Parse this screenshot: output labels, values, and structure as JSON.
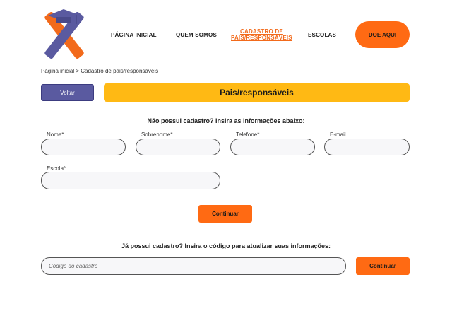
{
  "header": {
    "logo": {
      "icon": "graduation-logo-icon",
      "colors": {
        "orange": "#f26a1b",
        "purple": "#5a5aa0"
      }
    },
    "nav": [
      {
        "label": "PÁGINA INICIAL"
      },
      {
        "label": "QUEM SOMOS"
      },
      {
        "label_line1": "CADASTRO DE",
        "label_line2": "PAIS/RESPONSÁVEIS",
        "active": true
      },
      {
        "label": "ESCOLAS"
      }
    ],
    "donate_label": "DOE AQUI"
  },
  "breadcrumb": "Página inicial > Cadastro de pais/responsáveis",
  "back_label": "Voltar",
  "banner_title": "Pais/responsáveis",
  "new_section": {
    "title": "Não possui cadastro? Insira as informações abaixo:",
    "fields": {
      "nome": "Nome*",
      "sobrenome": "Sobrenome*",
      "telefone": "Telefone*",
      "email": "E-mail",
      "escola": "Escola*"
    },
    "continue_label": "Continuar"
  },
  "existing_section": {
    "title": "Já possui cadastro? Insira o código para atualizar suas informações:",
    "code_placeholder": "Código do cadastro",
    "continue_label": "Continuar"
  },
  "colors": {
    "accent_orange": "#ff6a13",
    "banner_yellow": "#ffb914",
    "button_purple": "#5a5aa0"
  }
}
